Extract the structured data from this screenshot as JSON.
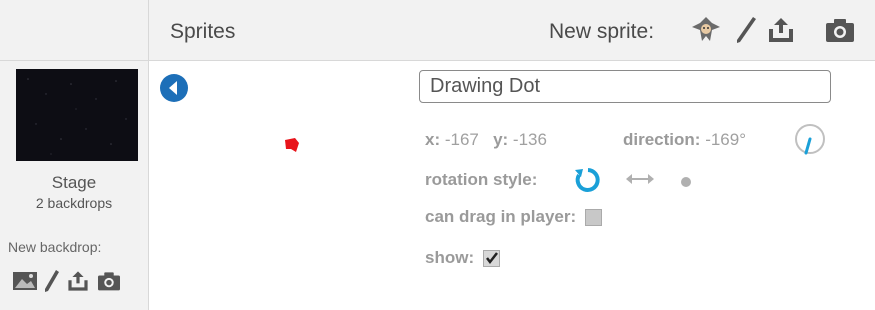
{
  "header": {
    "title": "Sprites",
    "new_sprite_label": "New sprite:"
  },
  "new_sprite_tools": [
    "choose-from-library-icon",
    "paint-brush-icon",
    "upload-icon",
    "camera-icon"
  ],
  "stage": {
    "label": "Stage",
    "backdrops": "2 backdrops",
    "new_backdrop_label": "New backdrop:"
  },
  "new_backdrop_tools": [
    "image-library-icon",
    "paint-brush-icon",
    "upload-icon",
    "camera-icon"
  ],
  "sprite": {
    "name": "Drawing Dot",
    "x_label": "x:",
    "x_value": "-167",
    "y_label": "y:",
    "y_value": "-136",
    "direction_label": "direction:",
    "direction_value": "-169°",
    "rotation_style_label": "rotation style:",
    "can_drag_label": "can drag in player:",
    "can_drag": false,
    "show_label": "show:",
    "show": true
  },
  "colors": {
    "accent": "#1aa0d8",
    "back_button": "#1d6fb8",
    "sprite": "#e8141b"
  }
}
